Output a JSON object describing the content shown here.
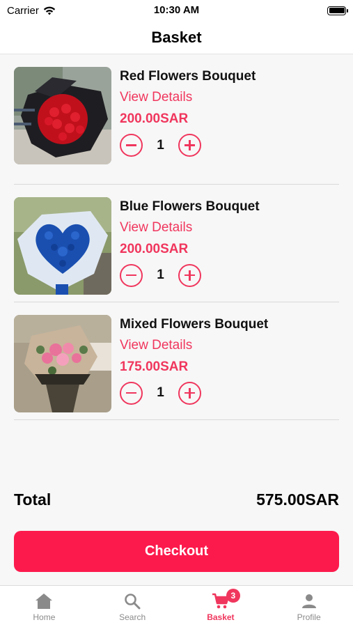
{
  "status_bar": {
    "carrier": "Carrier",
    "time": "10:30 AM"
  },
  "header": {
    "title": "Basket"
  },
  "cart": {
    "items": [
      {
        "name": "Red Flowers Bouquet",
        "details_label": "View Details",
        "price": "200.00SAR",
        "quantity": "1",
        "image": "red-roses-bouquet"
      },
      {
        "name": "Blue Flowers Bouquet",
        "details_label": "View Details",
        "price": "200.00SAR",
        "quantity": "1",
        "image": "blue-heart-bouquet"
      },
      {
        "name": "Mixed Flowers Bouquet",
        "details_label": "View Details",
        "price": "175.00SAR",
        "quantity": "1",
        "image": "pink-mixed-bouquet"
      }
    ]
  },
  "summary": {
    "total_label": "Total",
    "total_value": "575.00SAR"
  },
  "checkout": {
    "label": "Checkout"
  },
  "tab_bar": {
    "tabs": [
      {
        "label": "Home",
        "icon": "home-icon"
      },
      {
        "label": "Search",
        "icon": "search-icon"
      },
      {
        "label": "Basket",
        "icon": "cart-icon",
        "badge": "3",
        "active": true
      },
      {
        "label": "Profile",
        "icon": "person-icon"
      }
    ]
  },
  "colors": {
    "accent": "#f0365d",
    "checkout_bg": "#fc1a4c",
    "background": "#f7f7f7"
  }
}
